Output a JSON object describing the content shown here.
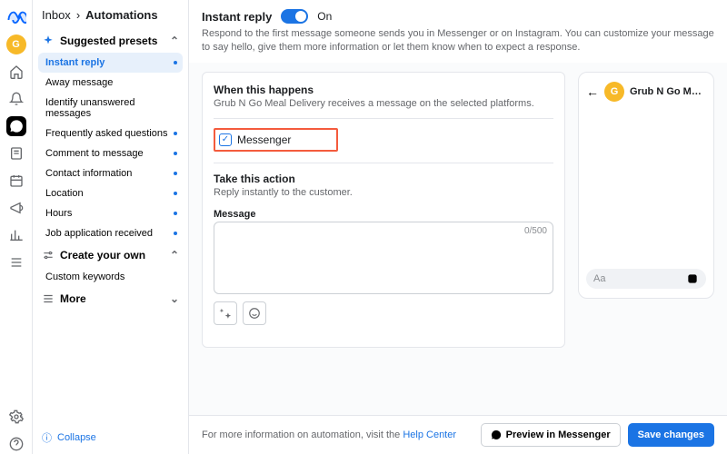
{
  "breadcrumb": {
    "parent": "Inbox",
    "current": "Automations"
  },
  "avatar_initial": "G",
  "sections": {
    "suggested": {
      "title": "Suggested presets",
      "items": [
        {
          "label": "Instant reply",
          "selected": true,
          "dot": true
        },
        {
          "label": "Away message",
          "dot": false
        },
        {
          "label": "Identify unanswered messages",
          "dot": false
        },
        {
          "label": "Frequently asked questions",
          "dot": true
        },
        {
          "label": "Comment to message",
          "dot": true
        },
        {
          "label": "Contact information",
          "dot": true
        },
        {
          "label": "Location",
          "dot": true
        },
        {
          "label": "Hours",
          "dot": true
        },
        {
          "label": "Job application received",
          "dot": true
        }
      ]
    },
    "custom": {
      "title": "Create your own",
      "items": [
        {
          "label": "Custom keywords"
        }
      ]
    },
    "more": {
      "title": "More"
    }
  },
  "collapse_label": "Collapse",
  "header": {
    "title": "Instant reply",
    "toggle_on": "On",
    "description": "Respond to the first message someone sends you in Messenger or on Instagram. You can customize your message to say hello, give them more information or let them know when to expect a response."
  },
  "editor": {
    "when_title": "When this happens",
    "when_desc": "Grub N Go Meal Delivery receives a message on the selected platforms.",
    "platform_label": "Messenger",
    "action_title": "Take this action",
    "action_desc": "Reply instantly to the customer.",
    "message_label": "Message",
    "message_counter": "0/500"
  },
  "preview": {
    "name": "Grub N Go M…",
    "avatar_initial": "G",
    "input_placeholder": "Aa"
  },
  "footer": {
    "info_prefix": "For more information on automation, visit the ",
    "help_link": "Help Center",
    "preview_btn": "Preview in Messenger",
    "save_btn": "Save changes"
  }
}
